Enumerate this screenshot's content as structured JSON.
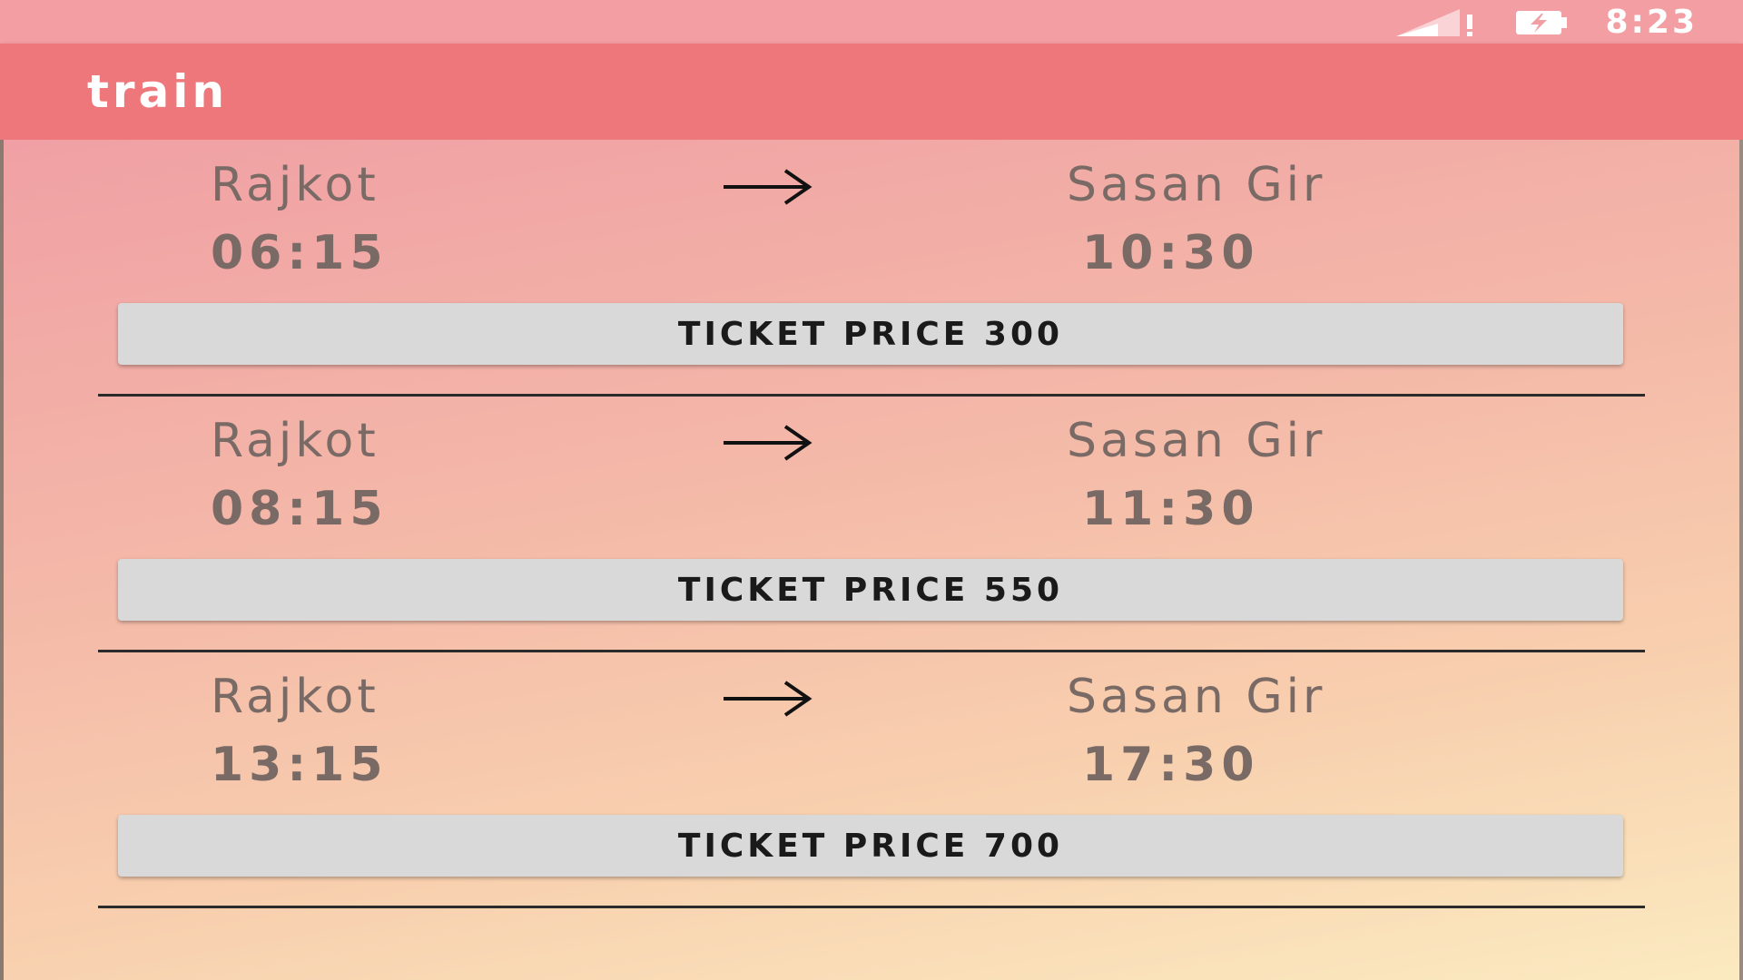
{
  "status_bar": {
    "time": "8:23",
    "signal_icon": "signal-strength-icon",
    "battery_icon": "battery-charging-icon"
  },
  "app_bar": {
    "title": "train"
  },
  "colors": {
    "status_bar": "#f29ea3",
    "app_bar": "#ee777b",
    "button": "#d9d9d9",
    "text": "#7a6a66"
  },
  "trains": [
    {
      "from": "Rajkot",
      "to": "Sasan Gir",
      "departure": "06:15",
      "arrival": "10:30",
      "price_label": "TICKET PRICE 300"
    },
    {
      "from": "Rajkot",
      "to": "Sasan Gir",
      "departure": "08:15",
      "arrival": "11:30",
      "price_label": "TICKET PRICE 550"
    },
    {
      "from": "Rajkot",
      "to": "Sasan Gir",
      "departure": "13:15",
      "arrival": "17:30",
      "price_label": "TICKET PRICE 700"
    }
  ]
}
